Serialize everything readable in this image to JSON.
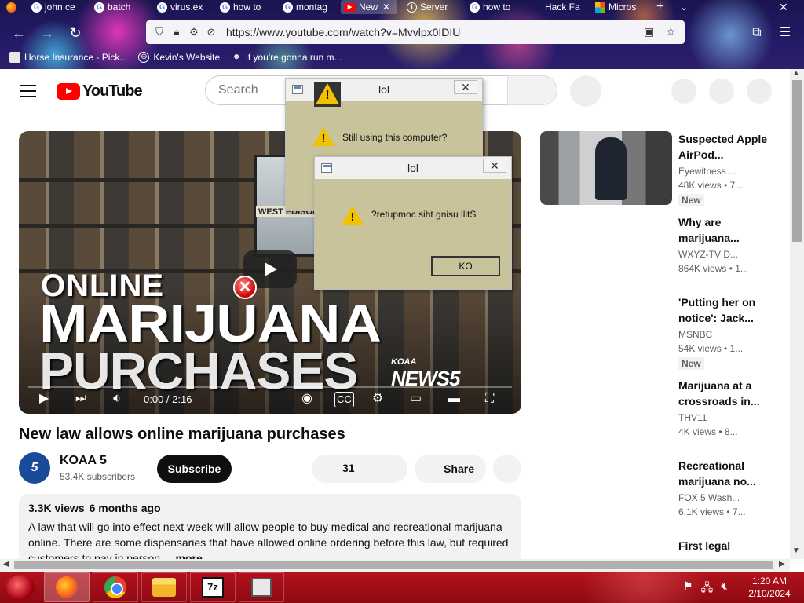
{
  "browser": {
    "tabs": [
      {
        "label": "john ce",
        "favicon": "google-g"
      },
      {
        "label": "batch",
        "favicon": "google-g"
      },
      {
        "label": "virus.ex",
        "favicon": "google-g"
      },
      {
        "label": "how to",
        "favicon": "google-g"
      },
      {
        "label": "montag",
        "favicon": "google-g"
      },
      {
        "label": "New",
        "favicon": "youtube"
      },
      {
        "label": "Server",
        "favicon": "info"
      },
      {
        "label": "how to",
        "favicon": "google-g"
      },
      {
        "label": "Hack Fa",
        "favicon": "none"
      },
      {
        "label": "Micros",
        "favicon": "microsoft"
      }
    ],
    "new_tab_symbol": "+",
    "tab_list_symbol": "⌄",
    "close_symbol": "✕",
    "url": "https://www.youtube.com/watch?v=Mvvlpx0IDIU",
    "bookmarks": [
      {
        "label": "Horse Insurance - Pick..."
      },
      {
        "label": "Kevin's Website"
      },
      {
        "label": "if you're gonna run m..."
      }
    ]
  },
  "youtube": {
    "logo_text": "YouTube",
    "search_placeholder": "Search",
    "video_overlay": {
      "line1": "ONLINE",
      "line2": "MARIJUANA",
      "line3": "PURCHASES",
      "store_sign": "WEST EDISON",
      "station_small": "KOAA",
      "station_big": "NEWS5"
    },
    "player": {
      "time": "0:00 / 2:16",
      "progress": 0
    },
    "video_title": "New law allows online marijuana purchases",
    "channel": {
      "avatar_text": "5",
      "name": "KOAA 5",
      "subscribers": "53.4K subscribers"
    },
    "subscribe_label": "Subscribe",
    "like_count": "31",
    "share_label": "Share",
    "description": {
      "views": "3.3K views",
      "date": "6 months ago",
      "text": "A law that will go into effect next week will allow people to buy medical and recreational marijuana online. There are some dispensaries that have allowed online ordering before this law, but required customers to pay in person.",
      "more_label": "...more"
    },
    "recommendations": [
      {
        "title": "Suspected Apple AirPod...",
        "channel": "Eyewitness ...",
        "meta": "48K views • 7...",
        "badge": "New"
      },
      {
        "title": "Why are marijuana...",
        "channel": "WXYZ-TV D...",
        "meta": "864K views • 1...",
        "badge": ""
      },
      {
        "title": "'Putting her on notice': Jack...",
        "channel": "MSNBC",
        "meta": "54K views • 1...",
        "badge": "New"
      },
      {
        "title": "Marijuana at a crossroads in...",
        "channel": "THV11",
        "meta": "4K views • 8...",
        "badge": ""
      },
      {
        "title": "Recreational marijuana no...",
        "channel": "FOX 5 Wash...",
        "meta": "6.1K views • 7...",
        "badge": ""
      },
      {
        "title": "First legal",
        "channel": "",
        "meta": "",
        "badge": ""
      }
    ]
  },
  "dialogs": [
    {
      "title": "lol",
      "message": "Still using this computer?",
      "button": ""
    },
    {
      "title": "lol",
      "message": "?retupmoc siht gnisu llitS",
      "button": "KO"
    }
  ],
  "dialog_close_symbol": "✕",
  "taskbar": {
    "apps": [
      "firefox",
      "chrome",
      "file-explorer",
      "7-zip",
      "app-window"
    ],
    "sevenzip_label": "7z",
    "time": "1:20 AM",
    "date": "2/10/2024"
  },
  "colors": {
    "youtube_red": "#ff0000",
    "dialog_bg": "#c9c39c",
    "taskbar_red": "#a8101a",
    "warning_yellow": "#f2c200"
  }
}
